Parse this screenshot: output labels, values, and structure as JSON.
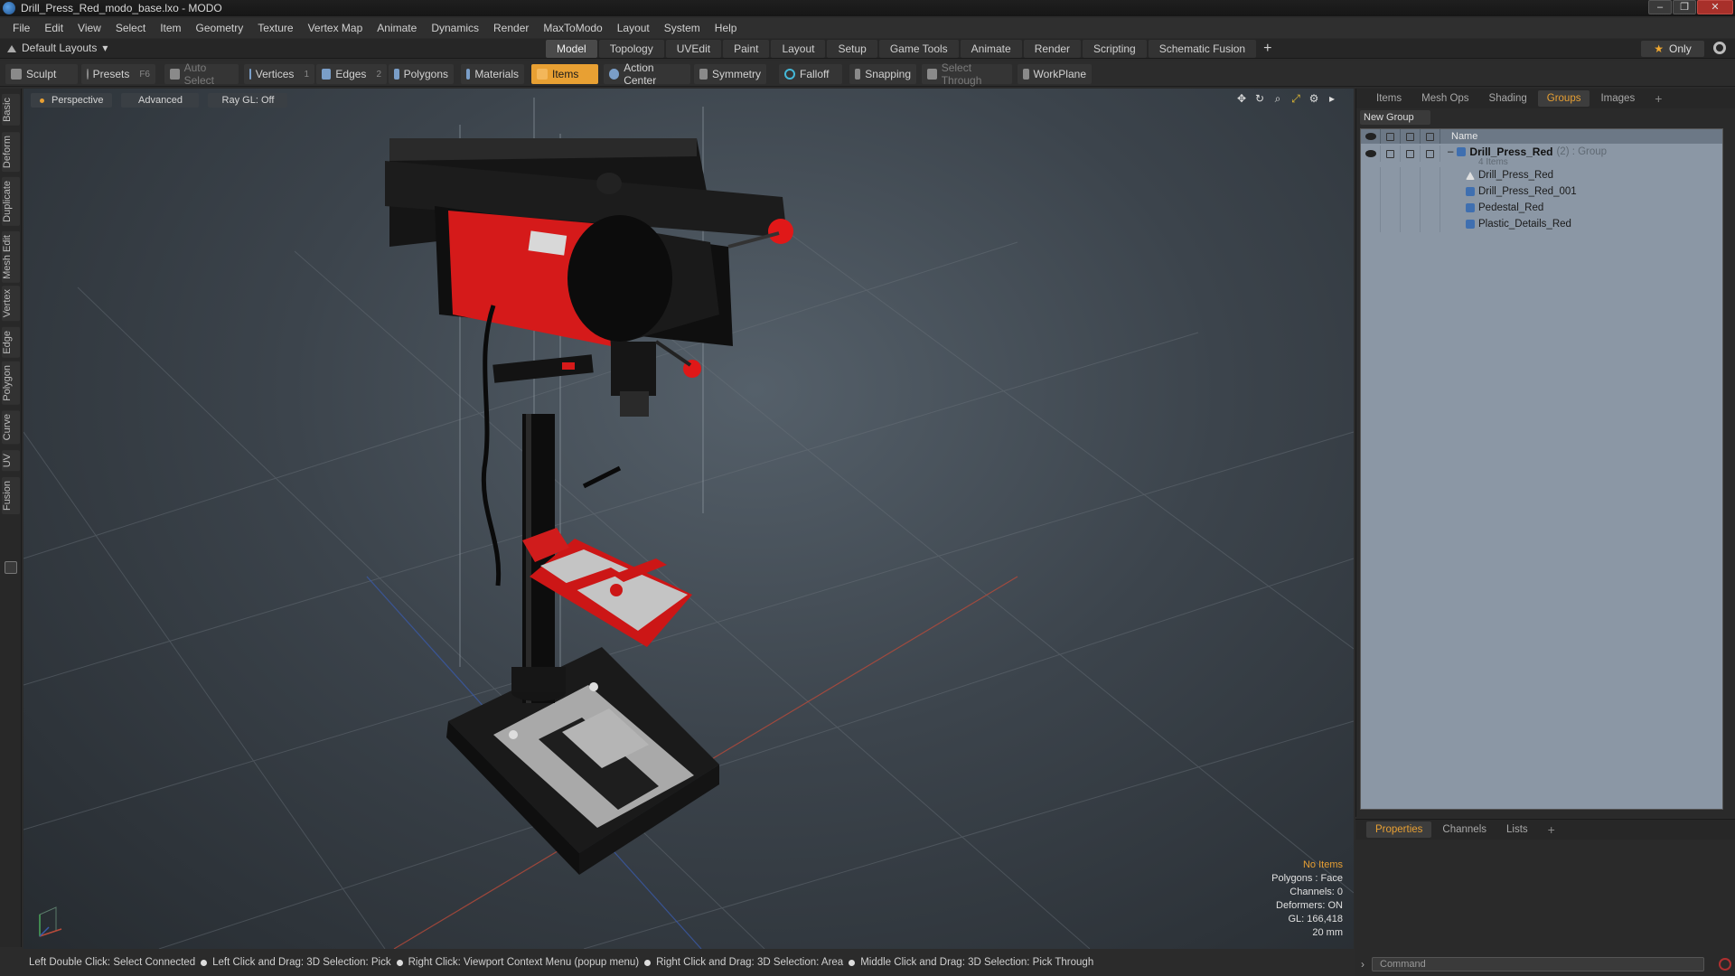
{
  "window": {
    "title": "Drill_Press_Red_modo_base.lxo - MODO"
  },
  "menu": [
    "File",
    "Edit",
    "View",
    "Select",
    "Item",
    "Geometry",
    "Texture",
    "Vertex Map",
    "Animate",
    "Dynamics",
    "Render",
    "MaxToModo",
    "Layout",
    "System",
    "Help"
  ],
  "layout_bar": {
    "default_layouts": "Default Layouts",
    "tabs": [
      "Model",
      "Topology",
      "UVEdit",
      "Paint",
      "Layout",
      "Setup",
      "Game Tools",
      "Animate",
      "Render",
      "Scripting",
      "Schematic Fusion"
    ],
    "active_tab": "Model",
    "only_label": "Only"
  },
  "toolbar": {
    "sculpt": "Sculpt",
    "presets": "Presets",
    "presets_key": "F6",
    "auto_select": "Auto Select",
    "vertices": "Vertices",
    "vertices_key": "1",
    "edges": "Edges",
    "edges_key": "2",
    "polygons": "Polygons",
    "materials": "Materials",
    "items": "Items",
    "action_center": "Action Center",
    "symmetry": "Symmetry",
    "falloff": "Falloff",
    "snapping": "Snapping",
    "select_through": "Select Through",
    "workplane": "WorkPlane"
  },
  "left_tabs": [
    "Basic",
    "Deform",
    "Duplicate",
    "Mesh Edit",
    "Vertex",
    "Edge",
    "Polygon",
    "Curve",
    "UV",
    "Fusion"
  ],
  "viewport": {
    "view": "Perspective",
    "shading": "Advanced",
    "raygl": "Ray GL: Off",
    "info": {
      "no_items": "No Items",
      "polygons": "Polygons : Face",
      "channels": "Channels: 0",
      "deformers": "Deformers: ON",
      "gl": "GL: 166,418",
      "scale": "20 mm"
    }
  },
  "status_bar": [
    "Left Double Click: Select Connected",
    "Left Click and Drag: 3D Selection: Pick",
    "Right Click: Viewport Context Menu (popup menu)",
    "Right Click and Drag: 3D Selection: Area",
    "Middle Click and Drag: 3D Selection: Pick Through"
  ],
  "right_panel": {
    "tabs": [
      "Items",
      "Mesh Ops",
      "Shading",
      "Groups",
      "Images"
    ],
    "active_tab": "Groups",
    "new_group": "New Group",
    "name_header": "Name",
    "group": {
      "name": "Drill_Press_Red",
      "meta": "(2) : Group",
      "count": "4 Items"
    },
    "items": [
      "Drill_Press_Red",
      "Drill_Press_Red_001",
      "Pedestal_Red",
      "Plastic_Details_Red"
    ]
  },
  "properties_panel": {
    "tabs": [
      "Properties",
      "Channels",
      "Lists"
    ],
    "active_tab": "Properties"
  },
  "command": {
    "placeholder": "Command"
  },
  "colors": {
    "accent": "#e8a033",
    "drill_red": "#e01818",
    "tree_bg": "#8b97a5"
  }
}
